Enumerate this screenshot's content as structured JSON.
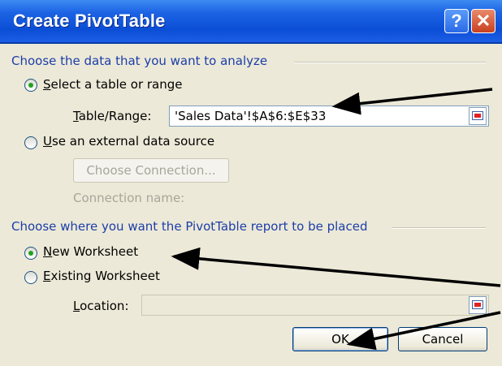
{
  "dialog": {
    "title": "Create PivotTable",
    "help_glyph": "?",
    "close_glyph": "✕"
  },
  "data_section": {
    "title": "Choose the data that you want to analyze",
    "select_range_label": "elect a table or range",
    "select_range_mnemonic": "S",
    "table_range_label": "able/Range:",
    "table_range_mnemonic": "T",
    "table_range_value": "'Sales Data'!$A$6:$E$33",
    "external_label": "se an external data source",
    "external_mnemonic": "U",
    "choose_connection_label": "Choose Connection...",
    "connection_name_label": "Connection name:"
  },
  "placement_section": {
    "title": "Choose where you want the PivotTable report to be placed",
    "new_ws_label": "ew Worksheet",
    "new_ws_mnemonic": "N",
    "existing_ws_label": "xisting Worksheet",
    "existing_ws_mnemonic": "E",
    "location_label": "ocation:",
    "location_mnemonic": "L",
    "location_value": ""
  },
  "buttons": {
    "ok": "OK",
    "cancel": "Cancel"
  },
  "state": {
    "selected_data_source": "select_range",
    "selected_placement": "new_worksheet"
  },
  "colors": {
    "section_title": "#1c3ea8",
    "radio_dot": "#21a121",
    "titlebar": "#0b4ed6"
  }
}
